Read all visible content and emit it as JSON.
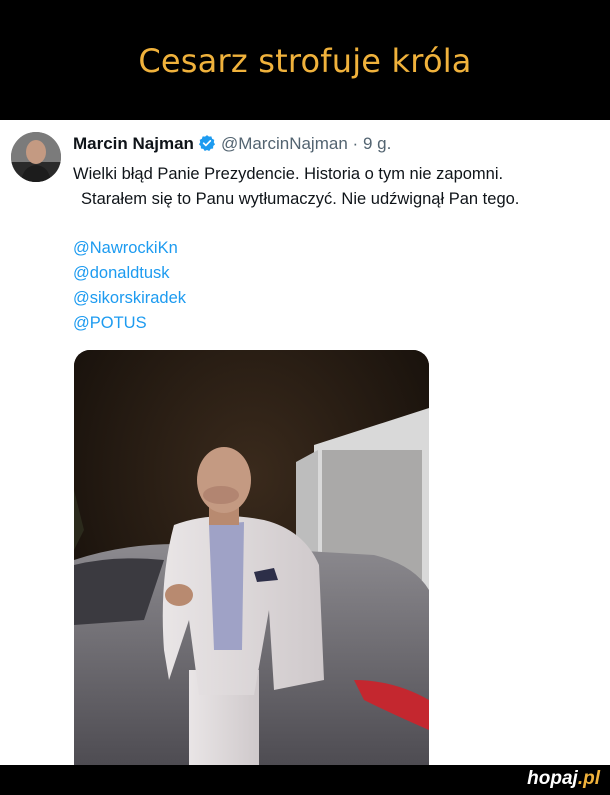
{
  "header": {
    "title": "Cesarz strofuje króla"
  },
  "tweet": {
    "author_name": "Marcin Najman",
    "handle": "@MarcinNajman",
    "separator": "·",
    "time": "9 g.",
    "text_line1": "Wielki błąd Panie Prezydencie. Historia o tym nie zapomni.",
    "text_line2": "Starałem się to Panu wytłumaczyć. Nie udźwignął Pan tego.",
    "mentions": [
      "@NawrockiKn",
      "@donaldtusk",
      "@sikorskiradek",
      "@POTUS"
    ],
    "icons": {
      "verified": "verified-badge-icon"
    },
    "colors": {
      "link": "#1d9bf0",
      "verified": "#1d9bf0",
      "text": "#0f1419",
      "muted": "#536471"
    }
  },
  "watermark": {
    "brand": "hopaj",
    "tld": ".pl"
  },
  "colors": {
    "title": "#f0b23c",
    "background": "#000000"
  }
}
